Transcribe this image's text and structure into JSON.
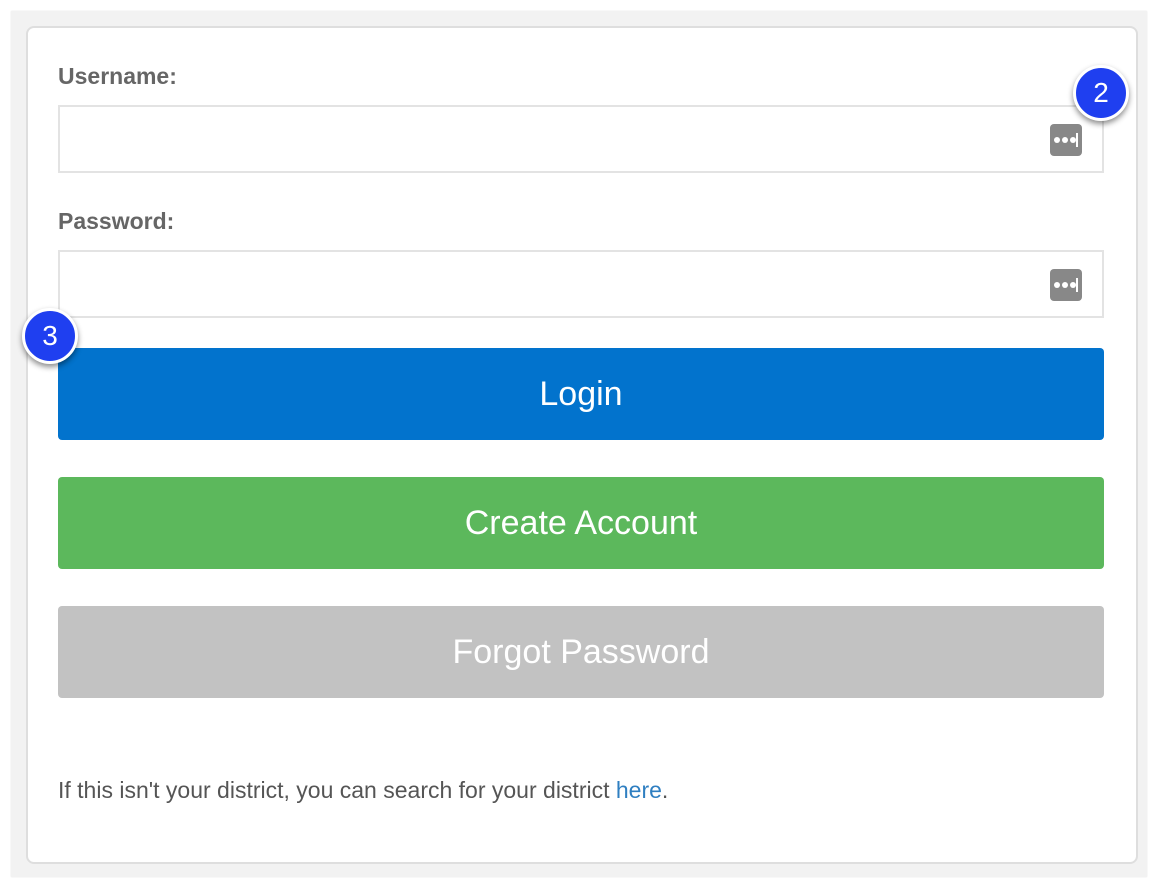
{
  "form": {
    "username_label": "Username:",
    "username_value": "",
    "password_label": "Password:",
    "password_value": ""
  },
  "buttons": {
    "login": "Login",
    "create_account": "Create Account",
    "forgot_password": "Forgot Password"
  },
  "footer": {
    "prefix": "If this isn't your district, you can search for your district ",
    "link": "here",
    "suffix": "."
  },
  "annotations": {
    "badge_username": "2",
    "badge_login": "3"
  },
  "icons": {
    "username_field": "password-manager-key-icon",
    "password_field": "password-manager-key-icon"
  },
  "colors": {
    "login_button": "#0273cd",
    "create_button": "#5cb85c",
    "forgot_button": "#c2c2c2",
    "link": "#2f7fc1",
    "badge": "#1f3ff0"
  }
}
